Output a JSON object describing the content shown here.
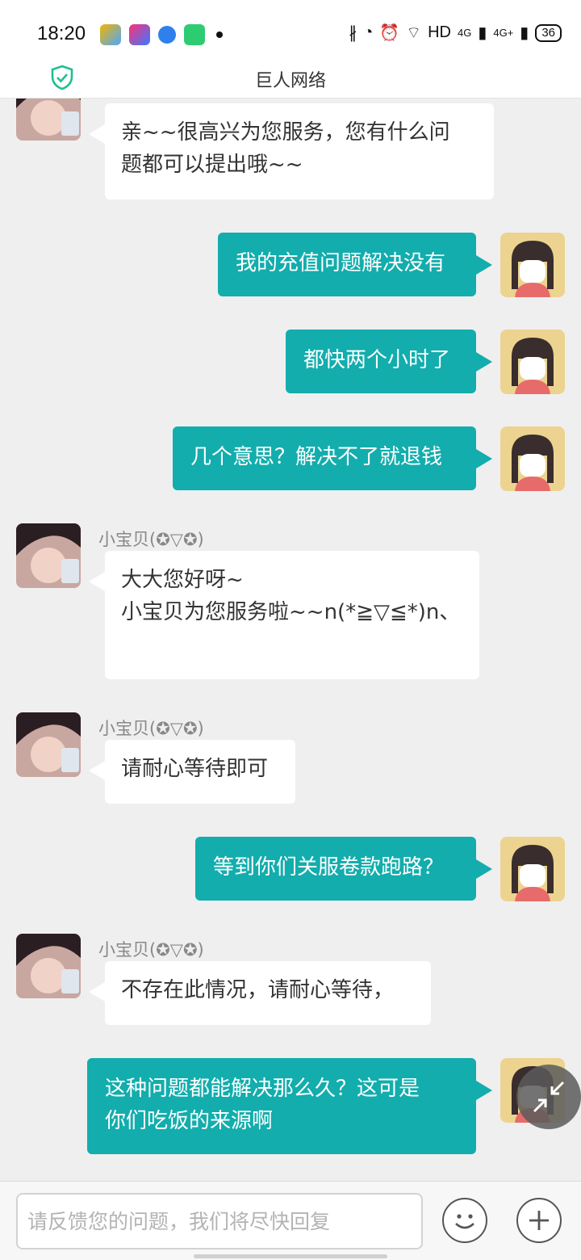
{
  "status_bar": {
    "time": "18:20",
    "right_text": "HD",
    "net1": "4G",
    "net2": "4G+",
    "battery": "36"
  },
  "header": {
    "title": "巨人网络"
  },
  "messages": [
    {
      "side": "in",
      "name": "",
      "lines": [
        "亲~~很高兴为您服务，您有什么问",
        "题都可以提出哦~~"
      ]
    },
    {
      "side": "out",
      "lines": [
        "我的充值问题解决没有"
      ]
    },
    {
      "side": "out",
      "lines": [
        "都快两个小时了"
      ]
    },
    {
      "side": "out",
      "lines": [
        "几个意思？解决不了就退钱"
      ]
    },
    {
      "side": "in",
      "name": "小宝贝(✪▽✪)",
      "lines": [
        "大大您好呀~",
        "小宝贝为您服务啦~~n(*≧▽≦*)n、"
      ]
    },
    {
      "side": "in",
      "name": "小宝贝(✪▽✪)",
      "lines": [
        "请耐心等待即可"
      ]
    },
    {
      "side": "out",
      "lines": [
        "等到你们关服卷款跑路？"
      ]
    },
    {
      "side": "in",
      "name": "小宝贝(✪▽✪)",
      "lines": [
        "不存在此情况，请耐心等待，"
      ]
    },
    {
      "side": "out",
      "lines": [
        "这种问题都能解决那么久？这可是",
        "你们吃饭的来源啊"
      ]
    }
  ],
  "input": {
    "placeholder": "请反馈您的问题，我们将尽快回复"
  },
  "colors": {
    "outgoing_bubble": "#13adad",
    "incoming_bubble": "#ffffff",
    "chat_bg": "#efefef"
  },
  "icons": [
    "shield-check-icon",
    "emoji-icon",
    "plus-icon",
    "minimize-icon"
  ]
}
